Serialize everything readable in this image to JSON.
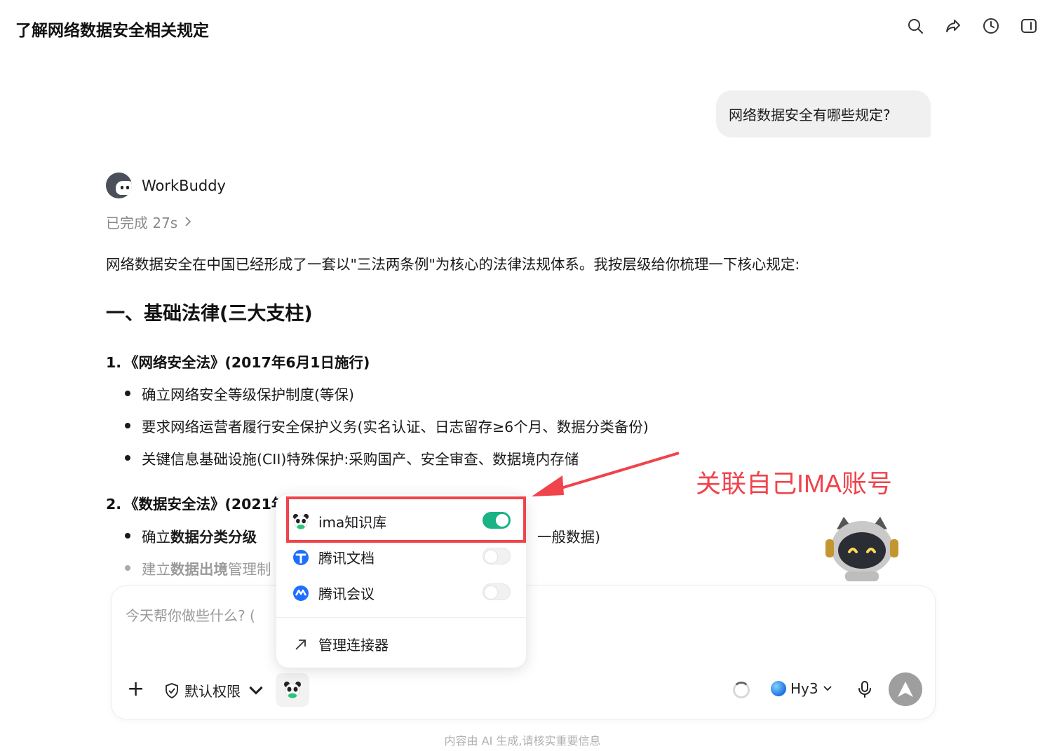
{
  "header": {
    "title": "了解网络数据安全相关规定",
    "icons": [
      "search-icon",
      "share-icon",
      "history-icon",
      "sidebar-toggle-icon"
    ]
  },
  "conversation": {
    "user_message": "网络数据安全有哪些规定?",
    "agent_name": "WorkBuddy",
    "status": "已完成 27s",
    "intro": "网络数据安全在中国已经形成了一套以\"三法两条例\"为核心的法律法规体系。我按层级给你梳理一下核心规定:",
    "heading": "一、基础法律(三大支柱)",
    "laws": [
      {
        "num": "1.",
        "title": "《网络安全法》(2017年6月1日施行)",
        "bullets": [
          "确立网络安全等级保护制度(等保)",
          "要求网络运营者履行安全保护义务(实名认证、日志留存≥6个月、数据分类备份)",
          "关键信息基础设施(CII)特殊保护:采购国产、安全审查、数据境内存储"
        ]
      },
      {
        "num": "2.",
        "title": "《数据安全法》(2021年",
        "bullets": [
          {
            "prefix": "确立",
            "bold": "数据分类分级",
            "tail": "一般数据)"
          },
          {
            "prefix": "建立",
            "bold": "数据出境",
            "tail": "管理制"
          }
        ]
      }
    ]
  },
  "annotation": {
    "text": "关联自己IMA账号",
    "color": "#f0434b"
  },
  "connector_popup": {
    "items": [
      {
        "label": "ima知识库",
        "enabled": true
      },
      {
        "label": "腾讯文档",
        "enabled": false
      },
      {
        "label": "腾讯会议",
        "enabled": false
      }
    ],
    "manage_label": "管理连接器",
    "toggle_on_color": "#19b386"
  },
  "composer": {
    "placeholder": "今天帮你做些什么? (",
    "permission_label": "默认权限",
    "model_label": "Hy3"
  },
  "footer": {
    "disclaimer": "内容由 AI 生成,请核实重要信息"
  }
}
